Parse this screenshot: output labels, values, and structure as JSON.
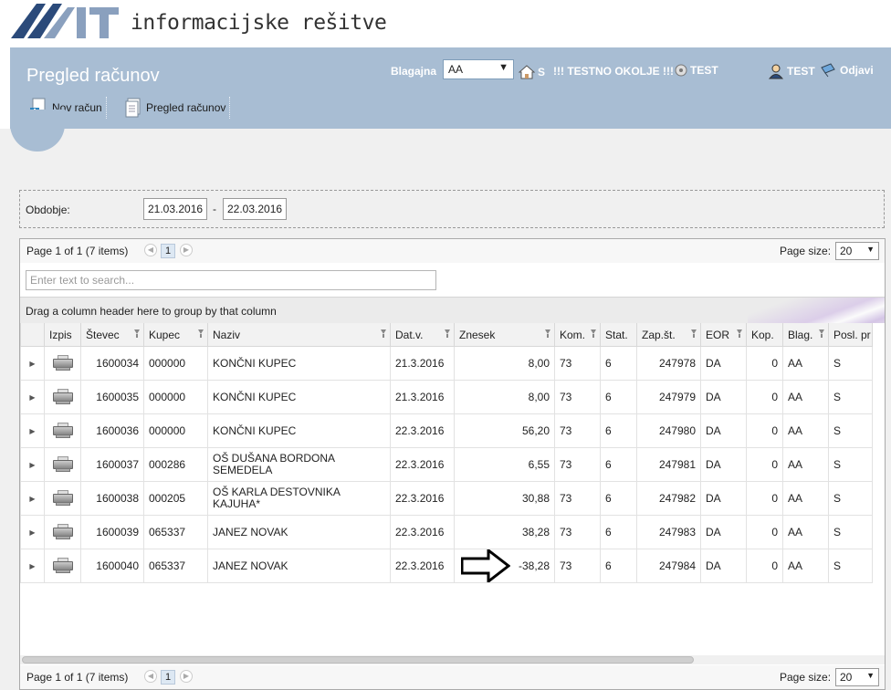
{
  "brand": {
    "logo_text": "MIT",
    "tagline": "informacijske rešitve"
  },
  "header": {
    "title": "Pregled računov",
    "buttons": [
      {
        "label": "Nov račun",
        "icon": "new-invoice-icon"
      },
      {
        "label": "Pregled računov",
        "icon": "invoice-list-icon"
      }
    ],
    "blagajna_label": "Blagajna",
    "blagajna_value": "AA",
    "home_label": "S",
    "environment_label": "!!! TESTNO OKOLJE !!!",
    "test_label": "TEST",
    "user_label": "TEST",
    "logout_label": "Odjavi"
  },
  "period": {
    "label": "Obdobje:",
    "from": "21.03.2016",
    "separator": "-",
    "to": "22.03.2016"
  },
  "grid": {
    "pager_info": "Page 1 of 1 (7 items)",
    "current_page": "1",
    "page_size_label": "Page size:",
    "page_size": "20",
    "search_placeholder": "Enter text to search...",
    "group_hint": "Drag a column header here to group by that column",
    "columns": [
      "",
      "Izpis",
      "Števec",
      "Kupec",
      "Naziv",
      "Dat.v.",
      "Znesek",
      "Kom.",
      "Stat.",
      "Zap.št.",
      "EOR",
      "Kop.",
      "Blag.",
      "Posl. pr"
    ],
    "rows": [
      {
        "stevec": "1600034",
        "kupec": "000000",
        "naziv": "KONČNI KUPEC",
        "datum": "21.3.2016",
        "znesek": "8,00",
        "kom": "73",
        "stat": "6",
        "zapst": "247978",
        "eor": "DA",
        "kop": "0",
        "blag": "AA",
        "posl": "S"
      },
      {
        "stevec": "1600035",
        "kupec": "000000",
        "naziv": "KONČNI KUPEC",
        "datum": "21.3.2016",
        "znesek": "8,00",
        "kom": "73",
        "stat": "6",
        "zapst": "247979",
        "eor": "DA",
        "kop": "0",
        "blag": "AA",
        "posl": "S"
      },
      {
        "stevec": "1600036",
        "kupec": "000000",
        "naziv": "KONČNI KUPEC",
        "datum": "22.3.2016",
        "znesek": "56,20",
        "kom": "73",
        "stat": "6",
        "zapst": "247980",
        "eor": "DA",
        "kop": "0",
        "blag": "AA",
        "posl": "S"
      },
      {
        "stevec": "1600037",
        "kupec": "000286",
        "naziv": "OŠ DUŠANA BORDONA SEMEDELA",
        "datum": "22.3.2016",
        "znesek": "6,55",
        "kom": "73",
        "stat": "6",
        "zapst": "247981",
        "eor": "DA",
        "kop": "0",
        "blag": "AA",
        "posl": "S"
      },
      {
        "stevec": "1600038",
        "kupec": "000205",
        "naziv": "OŠ KARLA DESTOVNIKA KAJUHA*",
        "datum": "22.3.2016",
        "znesek": "30,88",
        "kom": "73",
        "stat": "6",
        "zapst": "247982",
        "eor": "DA",
        "kop": "0",
        "blag": "AA",
        "posl": "S"
      },
      {
        "stevec": "1600039",
        "kupec": "065337",
        "naziv": "JANEZ NOVAK",
        "datum": "22.3.2016",
        "znesek": "38,28",
        "kom": "73",
        "stat": "6",
        "zapst": "247983",
        "eor": "DA",
        "kop": "0",
        "blag": "AA",
        "posl": "S"
      },
      {
        "stevec": "1600040",
        "kupec": "065337",
        "naziv": "JANEZ NOVAK",
        "datum": "22.3.2016",
        "znesek": "-38,28",
        "kom": "73",
        "stat": "6",
        "zapst": "247984",
        "eor": "DA",
        "kop": "0",
        "blag": "AA",
        "posl": "S"
      }
    ]
  },
  "colors": {
    "header_bg": "#a8bdd3",
    "content_bg": "#f0f0f0",
    "logo_blue": "#2b4a7a"
  }
}
